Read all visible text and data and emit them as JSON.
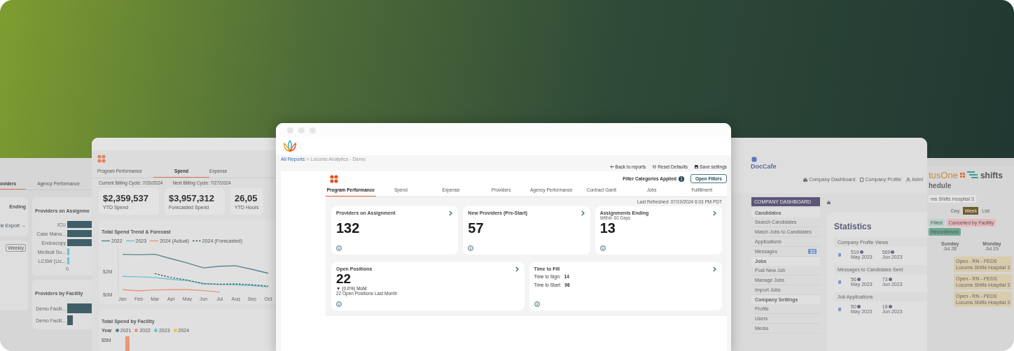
{
  "far_left_window": {
    "tabs": [
      {
        "label": "oviders",
        "selected": true
      },
      {
        "label": "Agency Performance",
        "selected": false
      }
    ],
    "card_title": "Ending",
    "export_link": "le Export →",
    "toggle": "Weekly",
    "chart_title": "Providers on Assignme",
    "bar_labels": [
      "ICU",
      "Case Mana...",
      "Endoscopy",
      "Medical Su...",
      "LCSW (Lic..."
    ],
    "axis_label": "0",
    "facility_title": "Providers by Facility",
    "facility_labels": [
      "Demo Facili...",
      "Demo Facili..."
    ]
  },
  "left_window": {
    "tabs": [
      {
        "label": "Program Performance",
        "selected": false
      },
      {
        "label": "Spend",
        "selected": true
      },
      {
        "label": "Expense",
        "selected": false
      }
    ],
    "billing": [
      "Current Billing Cycle: 7/20/2024",
      "Next Billing Cycle: 7/27/2024"
    ],
    "stats": [
      {
        "value": "$2,359,537",
        "label": "YTD Spend"
      },
      {
        "value": "$3,957,312",
        "label": "Forecasted Spend"
      },
      {
        "value": "26,05",
        "label": "YTD Hours"
      }
    ],
    "trend": {
      "chart_data": {
        "type": "line",
        "title": "Total Spend Trend & Forecast",
        "categories": [
          "Jan",
          "Feb",
          "Mar",
          "Apr",
          "May",
          "Jun",
          "Jul",
          "Aug",
          "Sep",
          "Oct"
        ],
        "ylim": [
          0,
          4
        ],
        "yticks": [
          {
            "value": 0,
            "label": "$0M"
          },
          {
            "value": 2,
            "label": "$2M"
          }
        ],
        "series": [
          {
            "name": "2022",
            "color": "#5b8590",
            "line_style": "solid",
            "values": [
              3.46,
              3.43,
              3.48,
              3.09,
              2.72,
              2.3,
              2.44,
              2.48,
              2.17,
              1.83
            ]
          },
          {
            "name": "2023",
            "color": "#6cc3cf",
            "line_style": "solid",
            "values": [
              1.56,
              1.52,
              1.46,
              1.3,
              1.19,
              0.94,
              0.87,
              0.83,
              0.76,
              0.65
            ]
          },
          {
            "name": "2024 (Actual)",
            "color": "#e9967a",
            "line_style": "solid",
            "values": [
              0.41,
              0.3,
              0.39,
              0.41,
              0.41,
              0.33,
              0.19,
              null,
              null,
              null
            ]
          },
          {
            "name": "2024 (Forecasted)",
            "color": "#3e5f68",
            "line_style": "dashed",
            "values": [
              null,
              null,
              1.8,
              1.46,
              1.24,
              0.91,
              0.87,
              0.91,
              0.83,
              0.72
            ]
          }
        ]
      }
    },
    "facility": {
      "title": "Total Spend by Facility",
      "legend_label": "Year",
      "legend": [
        {
          "label": "2021",
          "color": "#5b8590"
        },
        {
          "label": "2022",
          "color": "#e9967a"
        },
        {
          "label": "2023",
          "color": "#6cc3cf"
        },
        {
          "label": "2024",
          "color": "#e8c25a"
        }
      ],
      "tick": "$5M"
    }
  },
  "main_window": {
    "breadcrumb_link": "All Reports",
    "breadcrumb_rest": "> Locums Analytics - Demo",
    "actions": [
      {
        "kind": "back",
        "label": "Back to reports"
      },
      {
        "kind": "reset",
        "label": "Reset Defaults"
      },
      {
        "kind": "save",
        "label": "Save settings"
      }
    ],
    "filter_label": "Filter Categories Applied",
    "filter_count": "1",
    "open_filters": "Open Filters",
    "tabs": [
      {
        "label": "Program Performance",
        "selected": true
      },
      {
        "label": "Spend",
        "selected": false
      },
      {
        "label": "Expense",
        "selected": false
      },
      {
        "label": "Providers",
        "selected": false
      },
      {
        "label": "Agency Performance",
        "selected": false
      },
      {
        "label": "Contract Gantt",
        "selected": false
      },
      {
        "label": "Jobs",
        "selected": false
      },
      {
        "label": "Fulfillment",
        "selected": false
      }
    ],
    "last_refreshed": "Last Refreshed: 07/19/2024 6:03 PM PDT",
    "cards": [
      {
        "title": "Providers on Assignment",
        "value": "132"
      },
      {
        "title": "New Providers (Pre-Start)",
        "value": "57"
      },
      {
        "title": "Assignments Ending",
        "subtitle": "Within 60 Days",
        "value": "13"
      }
    ],
    "wide_cards": [
      {
        "kind": "metric",
        "title": "Open Positions",
        "value": "22",
        "change": "▼ (0.0%) MoM",
        "note": "22 Open Positions Last Month"
      },
      {
        "kind": "pairs",
        "title": "Time to Fill",
        "rows": [
          {
            "label": "Time to Sign:",
            "value": "14"
          },
          {
            "label": "Time to Start:",
            "value": "98"
          }
        ]
      }
    ]
  },
  "right_window": {
    "logo": "DocCafe",
    "nav": [
      {
        "kind": "home",
        "label": "Company Dashboard"
      },
      {
        "kind": "doc",
        "label": "Company Profile"
      },
      {
        "kind": "user",
        "label": "Admi"
      }
    ],
    "dashboard_button": "COMPANY DASHBOARD",
    "menu": [
      {
        "kind": "heading",
        "label": "Candidates"
      },
      {
        "kind": "item",
        "label": "Search Candidates"
      },
      {
        "kind": "item",
        "label": "Match Jobs to Candidates"
      },
      {
        "kind": "item",
        "label": "Applications"
      },
      {
        "kind": "item",
        "label": "Messages",
        "badge": "10"
      },
      {
        "kind": "heading",
        "label": "Jobs"
      },
      {
        "kind": "item",
        "label": "Post New Job"
      },
      {
        "kind": "item",
        "label": "Manage Jobs"
      },
      {
        "kind": "item",
        "label": "Import Jobs"
      },
      {
        "kind": "heading",
        "label": "Company Settings"
      },
      {
        "kind": "item",
        "label": "Profile"
      },
      {
        "kind": "item",
        "label": "Users"
      },
      {
        "kind": "item",
        "label": "Media"
      }
    ],
    "stats_title": "Statistics",
    "sections": [
      {
        "title": "Company Profile Views",
        "items": [
          {
            "value": "519",
            "period": "May 2023"
          },
          {
            "value": "569",
            "period": "Jun 2023"
          }
        ]
      },
      {
        "title": "Messages to Candidates Sent",
        "items": [
          {
            "value": "56",
            "period": "May 2023"
          },
          {
            "value": "73",
            "period": "Jun 2023"
          }
        ]
      },
      {
        "title": "Job Applications",
        "items": [
          {
            "value": "50",
            "period": "May 2023"
          },
          {
            "value": "18",
            "period": "Jun 2023"
          }
        ]
      }
    ]
  },
  "far_right_window": {
    "logo_text": "tusOne",
    "brand": "shifts",
    "heading": "hedule",
    "select_value": "ms Shifts Hospital 3",
    "views": [
      {
        "label": "Day",
        "selected": false
      },
      {
        "label": "Week",
        "selected": true
      },
      {
        "label": "List",
        "selected": false
      }
    ],
    "chips": [
      {
        "label": "Filled",
        "color": "#b9d3cc"
      },
      {
        "label": "Cancelled by Facility",
        "color": "#e7b7bb"
      },
      {
        "label": "Reconfirmed",
        "color": "#6fa894"
      }
    ],
    "days": [
      {
        "name": "Sunday",
        "date": "Jul 28"
      },
      {
        "name": "Monday",
        "date": "Jul 29"
      }
    ],
    "events": [
      {
        "title": "Open - RN - PEDS",
        "place": "Locums Shifts Hospital 3"
      },
      {
        "title": "Open - RN - PEDS",
        "place": "Locums Shifts Hospital 3"
      },
      {
        "title": "Open - RN - PEDS",
        "place": "Locums Shifts Hospital 3"
      }
    ]
  }
}
